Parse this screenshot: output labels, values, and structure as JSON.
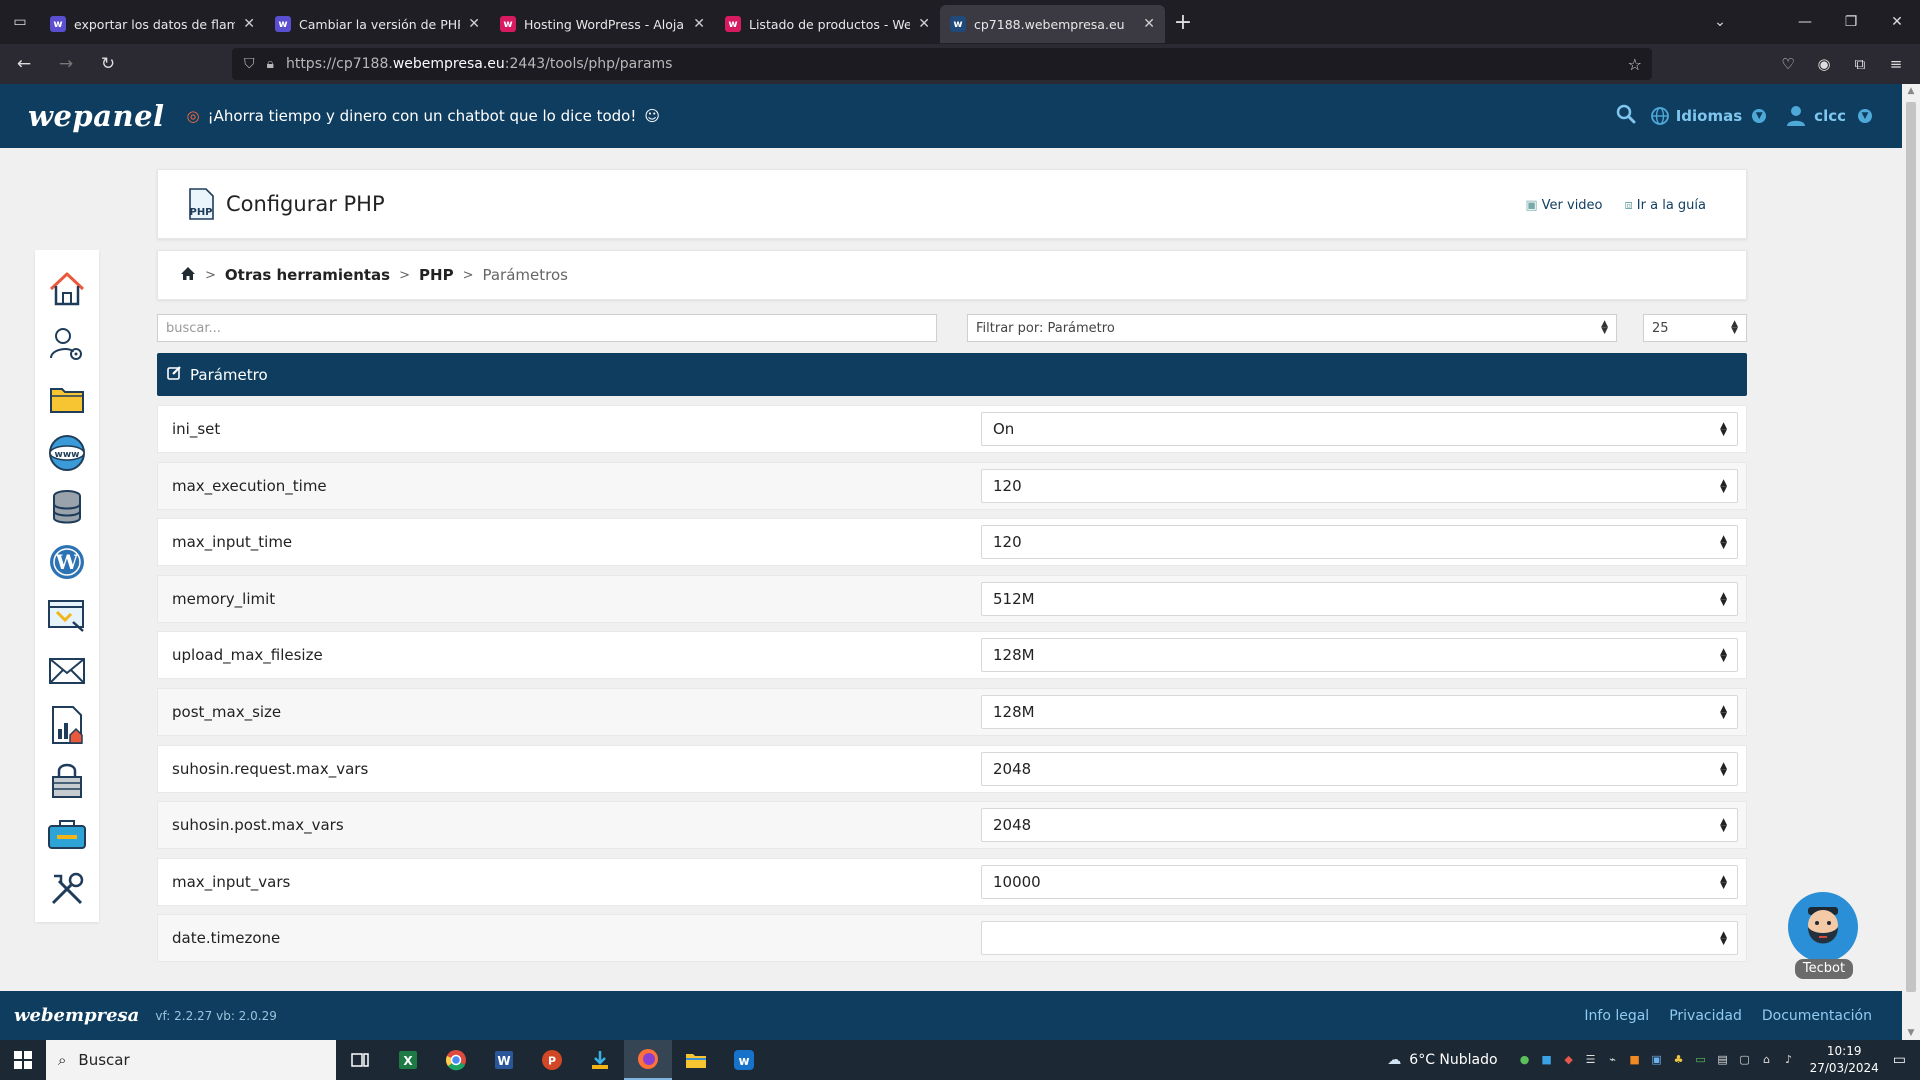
{
  "browser": {
    "tabs": [
      {
        "title": "exportar los datos de flamingo",
        "favicon_color": "#5a4fcf",
        "favicon_letter": "w"
      },
      {
        "title": "Cambiar la versión de PHP - Pr",
        "favicon_color": "#5a4fcf",
        "favicon_letter": "w"
      },
      {
        "title": "Hosting WordPress - Alojamien",
        "favicon_color": "#d81b60",
        "favicon_letter": "w"
      },
      {
        "title": "Listado de productos - Webem",
        "favicon_color": "#d81b60",
        "favicon_letter": "w"
      },
      {
        "title": "cp7188.webempresa.eu",
        "favicon_color": "#1f4a7a",
        "favicon_letter": "w",
        "active": true
      }
    ],
    "url_prefix": "https://cp7188.",
    "url_host": "webempresa.eu",
    "url_path": ":2443/tools/php/params"
  },
  "header": {
    "logo": "wepanel",
    "promo": "¡Ahorra tiempo y dinero con un chatbot que lo dice todo!",
    "language_label": "Idiomas",
    "user_label": "clcc"
  },
  "page": {
    "title": "Configurar PHP",
    "video_link": "Ver video",
    "guide_link": "Ir a la guía"
  },
  "breadcrumb": {
    "level1": "Otras herramientas",
    "level2": "PHP",
    "current": "Parámetros"
  },
  "filters": {
    "search_placeholder": "buscar...",
    "filter_by": "Filtrar por: Parámetro",
    "page_size": "25"
  },
  "table": {
    "header": "Parámetro",
    "rows": [
      {
        "name": "ini_set",
        "value": "On"
      },
      {
        "name": "max_execution_time",
        "value": "120"
      },
      {
        "name": "max_input_time",
        "value": "120"
      },
      {
        "name": "memory_limit",
        "value": "512M"
      },
      {
        "name": "upload_max_filesize",
        "value": "128M"
      },
      {
        "name": "post_max_size",
        "value": "128M"
      },
      {
        "name": "suhosin.request.max_vars",
        "value": "2048"
      },
      {
        "name": "suhosin.post.max_vars",
        "value": "2048"
      },
      {
        "name": "max_input_vars",
        "value": "10000"
      },
      {
        "name": "date.timezone",
        "value": ""
      }
    ]
  },
  "chatbot": {
    "name": "Tecbot"
  },
  "footer": {
    "logo": "webempresa",
    "version": "vf: 2.2.27 vb: 2.0.29",
    "links": [
      "Info legal",
      "Privacidad",
      "Documentación"
    ]
  },
  "taskbar": {
    "search_label": "Buscar",
    "weather": "6°C  Nublado",
    "time": "10:19",
    "date": "27/03/2024"
  },
  "colors": {
    "brand_navy": "#0f3d5f",
    "link_blue": "#7fc6ef"
  }
}
